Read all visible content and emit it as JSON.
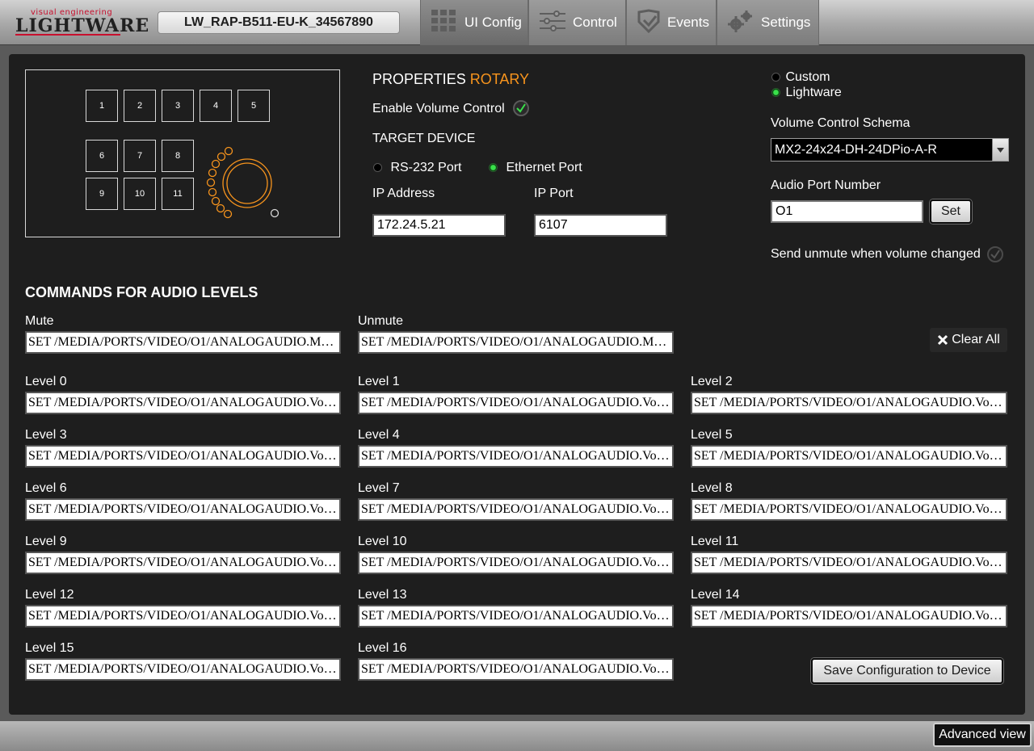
{
  "header": {
    "logo_tagline": "visual engineering",
    "logo_text": "LIGHTWARE",
    "device_name": "LW_RAP-B511-EU-K_34567890",
    "tabs": [
      {
        "label": "UI Config",
        "icon": "grid-icon",
        "active": true
      },
      {
        "label": "Control",
        "icon": "sliders-icon",
        "active": false
      },
      {
        "label": "Events",
        "icon": "events-icon",
        "active": false
      },
      {
        "label": "Settings",
        "icon": "gear-icon",
        "active": false
      }
    ]
  },
  "preview": {
    "buttons": [
      "1",
      "2",
      "3",
      "4",
      "5",
      "6",
      "7",
      "8",
      "9",
      "10",
      "11"
    ]
  },
  "properties": {
    "heading": "PROPERTIES",
    "heading_accent": "ROTARY",
    "enable_volume_label": "Enable Volume Control",
    "enable_volume_checked": true,
    "target_device_label": "TARGET DEVICE",
    "rs232_label": "RS-232 Port",
    "ethernet_label": "Ethernet Port",
    "selected_port": "ethernet",
    "ip_address_label": "IP Address",
    "ip_address_value": "172.24.5.21",
    "ip_port_label": "IP Port",
    "ip_port_value": "6107"
  },
  "schema": {
    "custom_label": "Custom",
    "lightware_label": "Lightware",
    "selected": "lightware",
    "volume_schema_label": "Volume Control Schema",
    "volume_schema_value": "MX2-24x24-DH-24DPio-A-R",
    "audio_port_label": "Audio Port Number",
    "audio_port_value": "O1",
    "set_label": "Set",
    "unmute_label": "Send unmute when volume changed",
    "unmute_checked": false
  },
  "commands": {
    "heading": "COMMANDS FOR AUDIO LEVELS",
    "clear_all_label": "Clear All",
    "mute_label": "Mute",
    "mute_value": "SET /MEDIA/PORTS/VIDEO/O1/ANALOGAUDIO.M…",
    "unmute_label": "Unmute",
    "unmute_value": "SET /MEDIA/PORTS/VIDEO/O1/ANALOGAUDIO.M…",
    "levels": [
      {
        "label": "Level 0",
        "value": "SET /MEDIA/PORTS/VIDEO/O1/ANALOGAUDIO.Vo…"
      },
      {
        "label": "Level 1",
        "value": "SET /MEDIA/PORTS/VIDEO/O1/ANALOGAUDIO.Vo…"
      },
      {
        "label": "Level 2",
        "value": "SET /MEDIA/PORTS/VIDEO/O1/ANALOGAUDIO.Vo…"
      },
      {
        "label": "Level 3",
        "value": "SET /MEDIA/PORTS/VIDEO/O1/ANALOGAUDIO.Vo…"
      },
      {
        "label": "Level 4",
        "value": "SET /MEDIA/PORTS/VIDEO/O1/ANALOGAUDIO.Vo…"
      },
      {
        "label": "Level 5",
        "value": "SET /MEDIA/PORTS/VIDEO/O1/ANALOGAUDIO.Vo…"
      },
      {
        "label": "Level 6",
        "value": "SET /MEDIA/PORTS/VIDEO/O1/ANALOGAUDIO.Vo…"
      },
      {
        "label": "Level 7",
        "value": "SET /MEDIA/PORTS/VIDEO/O1/ANALOGAUDIO.Vo…"
      },
      {
        "label": "Level 8",
        "value": "SET /MEDIA/PORTS/VIDEO/O1/ANALOGAUDIO.Vo…"
      },
      {
        "label": "Level 9",
        "value": "SET /MEDIA/PORTS/VIDEO/O1/ANALOGAUDIO.Vo…"
      },
      {
        "label": "Level 10",
        "value": "SET /MEDIA/PORTS/VIDEO/O1/ANALOGAUDIO.Vo…"
      },
      {
        "label": "Level 11",
        "value": "SET /MEDIA/PORTS/VIDEO/O1/ANALOGAUDIO.Vo…"
      },
      {
        "label": "Level 12",
        "value": "SET /MEDIA/PORTS/VIDEO/O1/ANALOGAUDIO.Vo…"
      },
      {
        "label": "Level 13",
        "value": "SET /MEDIA/PORTS/VIDEO/O1/ANALOGAUDIO.Vo…"
      },
      {
        "label": "Level 14",
        "value": "SET /MEDIA/PORTS/VIDEO/O1/ANALOGAUDIO.Vo…"
      },
      {
        "label": "Level 15",
        "value": "SET /MEDIA/PORTS/VIDEO/O1/ANALOGAUDIO.Vo…"
      },
      {
        "label": "Level 16",
        "value": "SET /MEDIA/PORTS/VIDEO/O1/ANALOGAUDIO.Vo…"
      }
    ],
    "save_label": "Save Configuration to Device"
  },
  "footer": {
    "advanced_view_label": "Advanced view"
  },
  "colors": {
    "accent_orange": "#f7941d",
    "radio_green": "#39e04a",
    "panel_bg": "#1e1e1e"
  }
}
